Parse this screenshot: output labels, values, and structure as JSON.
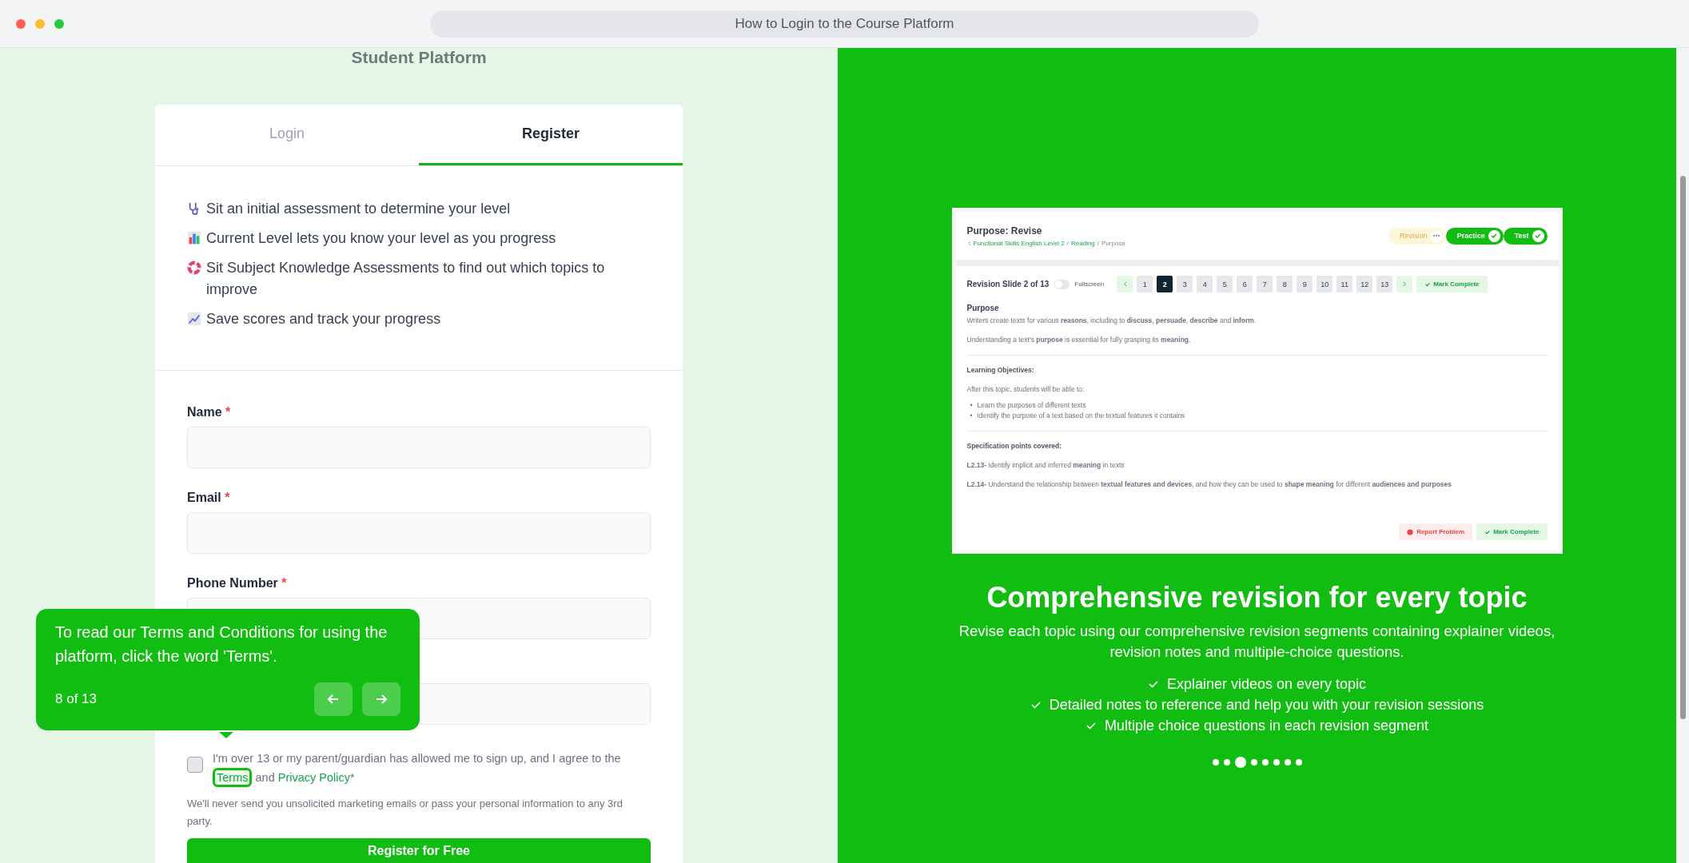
{
  "window": {
    "title": "How to Login to the Course Platform"
  },
  "left": {
    "heading": "Student Platform",
    "tabs": [
      {
        "label": "Login",
        "selected": false
      },
      {
        "label": "Register",
        "selected": true
      }
    ],
    "features": [
      {
        "kind": "stethoscope",
        "text": "Sit an initial assessment to determine your level"
      },
      {
        "kind": "barchart",
        "text": "Current Level lets you know your level as you progress"
      },
      {
        "kind": "lifebuoy",
        "text": "Sit Subject Knowledge Assessments to find out which topics to improve"
      },
      {
        "kind": "trend",
        "text": "Save scores and track your progress"
      }
    ],
    "fields": [
      {
        "kind": "labeled",
        "label": "Name",
        "required_mark": "*"
      },
      {
        "kind": "labeled",
        "label": "Email",
        "required_mark": "*"
      },
      {
        "kind": "labeled",
        "label": "Phone Number",
        "required_mark": "*"
      },
      {
        "kind": "covered"
      }
    ],
    "consent": {
      "checked": false,
      "text": "I'm over 13 or my parent/guardian has allowed me to sign up, and I agree to the ",
      "terms_link": "Terms",
      "terms_highlighted": true,
      "joiner": " and ",
      "privacy_link": "Privacy Policy",
      "suffix": "*"
    },
    "note": "We'll never send you unsolicited marketing emails or pass your personal information to any 3rd party.",
    "submit": "Register for Free"
  },
  "tooltip": {
    "text": "To read our Terms and Conditions for using the platform, click the word 'Terms'.",
    "counter": "8 of 13"
  },
  "right": {
    "preview": {
      "title": "Purpose: Revise",
      "breadcrumb": [
        {
          "label": "Functional Skills English Level 2",
          "link": true
        },
        {
          "label": "Reading",
          "link": true
        },
        {
          "label": "Purpose",
          "link": false
        }
      ],
      "breadcrumb_separator": "/",
      "stages": [
        {
          "label": "Revision",
          "done": false
        },
        {
          "label": "Practice",
          "done": true
        },
        {
          "label": "Test",
          "done": true
        }
      ],
      "slide_label": "Revision Slide 2 of 13",
      "fullscreen": {
        "label": "Fullscreen",
        "on": false
      },
      "pages": [
        {
          "label": "1",
          "selected": false
        },
        {
          "label": "2",
          "selected": true
        },
        {
          "label": "3",
          "selected": false
        },
        {
          "label": "4",
          "selected": false
        },
        {
          "label": "5",
          "selected": false
        },
        {
          "label": "6",
          "selected": false
        },
        {
          "label": "7",
          "selected": false
        },
        {
          "label": "8",
          "selected": false
        },
        {
          "label": "9",
          "selected": false
        },
        {
          "label": "10",
          "selected": false
        },
        {
          "label": "11",
          "selected": false
        },
        {
          "label": "12",
          "selected": false
        },
        {
          "label": "13",
          "selected": false
        }
      ],
      "mark_complete_top": "Mark Complete",
      "section_title": "Purpose",
      "purpose_lines": [
        "Writers create texts for various **reasons**, including to **discuss**, **persuade**, **describe** and **inform**.",
        "Understanding a text's **purpose** is essential for fully grasping its **meaning**."
      ],
      "objectives_title": "Learning Objectives:",
      "objectives_intro": "After this topic, students will be able to:",
      "bullet": "•",
      "objectives": [
        "Learn the purposes of different texts",
        "Identify the purpose of a text based on the textual features it contains"
      ],
      "spec_title": "**Specification points** covered:",
      "spec_points": [
        "**L2.13-** Identify implicit and inferred **meaning** in texts",
        "**L2.14-** Understand the relationship between **textual features and devices**, and how they can be used to **shape meaning** for different **audiences and purposes**"
      ],
      "report_button": "Report Problem",
      "mark_complete_bottom": "Mark Complete"
    },
    "heading": "Comprehensive revision for every topic",
    "subtitle": "Revise each topic using our comprehensive revision segments containing explainer videos, revision notes and multiple-choice questions.",
    "checks": [
      "Explainer videos on every topic",
      "Detailed notes to reference and help you with your revision sessions",
      "Multiple choice questions in each revision segment"
    ],
    "dots": [
      {
        "selected": false
      },
      {
        "selected": false
      },
      {
        "selected": true
      },
      {
        "selected": false
      },
      {
        "selected": false
      },
      {
        "selected": false
      },
      {
        "selected": false
      },
      {
        "selected": false
      }
    ]
  }
}
